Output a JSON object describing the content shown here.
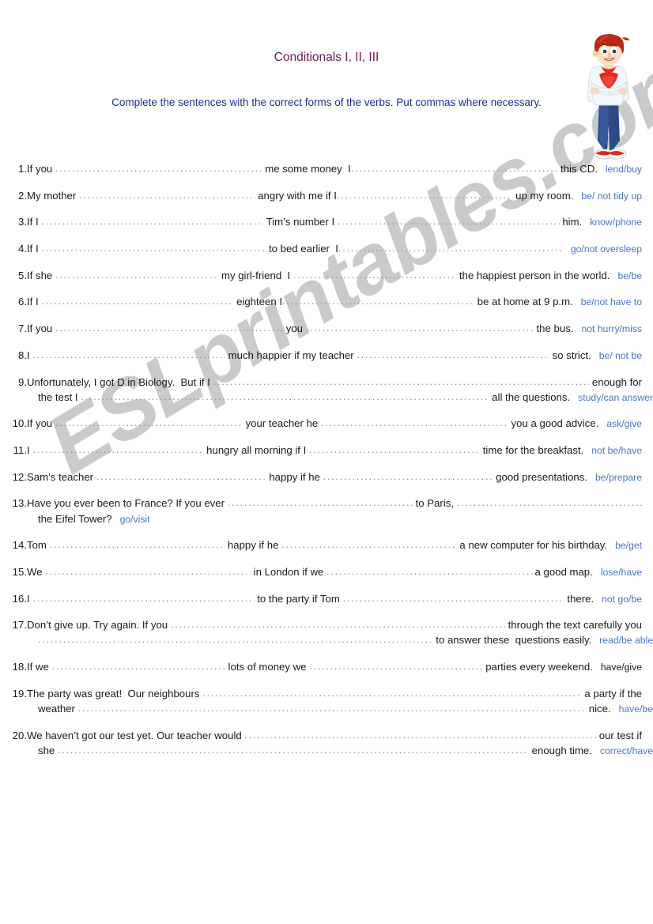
{
  "header": {
    "title": "Conditionals I, II, III",
    "instruction": "Complete the sentences with the correct forms of the verbs. Put commas where necessary."
  },
  "watermark": {
    "text": "ESLprintables.com"
  },
  "illustration": {
    "name": "boy-with-crossed-arms",
    "hair_color": "#b82a17",
    "shirt_color": "#f2f7fb",
    "shirt_accent_color": "#e02a1c",
    "jeans_color": "#2e4a86",
    "shoe_color": "#e02a1c",
    "skin_color": "#f7d9bd"
  },
  "colors": {
    "title": "#6b1a56",
    "instruction": "#1f2f8e",
    "cue": "#4876c4",
    "body": "#1a1a1a",
    "dots": "#8e8e8e",
    "watermark": "#c9cacb"
  },
  "exercises": [
    {
      "number": "1.",
      "lines": [
        {
          "parts": [
            "If you ",
            "BLANK",
            " me some money  I",
            "BLANK",
            " this CD."
          ]
        }
      ],
      "cue": "lend/buy",
      "cue_color": "blue"
    },
    {
      "number": "2.",
      "lines": [
        {
          "parts": [
            "My mother ",
            "BLANK",
            " angry with me if I",
            "BLANK",
            " up my room."
          ]
        }
      ],
      "cue": "be/ not tidy up",
      "cue_color": "blue"
    },
    {
      "number": "3.",
      "lines": [
        {
          "parts": [
            "If I ",
            "BLANK",
            " Tim’s number I ",
            "BLANK",
            " him."
          ]
        }
      ],
      "cue": "know/phone",
      "cue_color": "blue"
    },
    {
      "number": "4.",
      "lines": [
        {
          "parts": [
            "If I ",
            "BLANK",
            " to bed earlier  I",
            "BLANK",
            ""
          ]
        }
      ],
      "cue": "go/not oversleep",
      "cue_color": "blue"
    },
    {
      "number": "5.",
      "lines": [
        {
          "parts": [
            "If she ",
            "BLANK",
            " my girl-friend  I ",
            "BLANK",
            " the happiest person in the world."
          ]
        }
      ],
      "cue": "be/be",
      "cue_color": "blue"
    },
    {
      "number": "6.",
      "lines": [
        {
          "parts": [
            "If I ",
            "BLANK",
            " eighteen I",
            "BLANK",
            " be at home at 9 p.m."
          ]
        }
      ],
      "cue": "be/not have to",
      "cue_color": "blue"
    },
    {
      "number": "7.",
      "lines": [
        {
          "parts": [
            "If you ",
            "BLANK",
            " you ",
            "BLANK",
            " the bus."
          ]
        }
      ],
      "cue": "not hurry/miss",
      "cue_color": "blue"
    },
    {
      "number": "8.",
      "lines": [
        {
          "parts": [
            "I ",
            "BLANK",
            " much happier if my teacher ",
            "BLANK",
            " so strict."
          ]
        }
      ],
      "cue": "be/ not be",
      "cue_color": "blue"
    },
    {
      "number": "9.",
      "lines": [
        {
          "parts": [
            "Unfortunately, I got D in Biology.  But if I ",
            "BLANK",
            " enough for"
          ]
        },
        {
          "parts": [
            "the test I ",
            "BLANK",
            " all the questions."
          ]
        }
      ],
      "cue": "study/can answer",
      "cue_color": "blue"
    },
    {
      "number": "10.",
      "lines": [
        {
          "parts": [
            "If you ",
            "BLANK",
            " your teacher he ",
            "BLANK",
            " you a good advice."
          ]
        }
      ],
      "cue": "ask/give",
      "cue_color": "blue"
    },
    {
      "number": "11.",
      "lines": [
        {
          "parts": [
            "I ",
            "BLANK",
            " hungry all morning if I ",
            "BLANK",
            " time for the breakfast."
          ]
        }
      ],
      "cue": "not be/have",
      "cue_color": "blue"
    },
    {
      "number": "12.",
      "lines": [
        {
          "parts": [
            "Sam’s teacher ",
            "BLANK",
            " happy if he ",
            "BLANK",
            " good presentations."
          ]
        }
      ],
      "cue": "be/prepare",
      "cue_color": "blue"
    },
    {
      "number": "13.",
      "lines": [
        {
          "parts": [
            "Have you ever been to France? If you ever ",
            "BLANK",
            " to Paris, ",
            "BLANK",
            ""
          ]
        },
        {
          "parts": [
            "the Eifel Tower?"
          ]
        }
      ],
      "cue": "go/visit",
      "cue_color": "blue"
    },
    {
      "number": "14.",
      "lines": [
        {
          "parts": [
            "Tom ",
            "BLANK",
            " happy if he ",
            "BLANK",
            " a new computer for his birthday."
          ]
        }
      ],
      "cue": "be/get",
      "cue_color": "blue"
    },
    {
      "number": "15.",
      "lines": [
        {
          "parts": [
            "We ",
            "BLANK",
            " in London if we ",
            "BLANK",
            " a good map."
          ]
        }
      ],
      "cue": "lose/have",
      "cue_color": "blue"
    },
    {
      "number": "16.",
      "lines": [
        {
          "parts": [
            "I ",
            "BLANK",
            " to the party if Tom ",
            "BLANK",
            " there."
          ]
        }
      ],
      "cue": "not go/be",
      "cue_color": "blue"
    },
    {
      "number": "17.",
      "lines": [
        {
          "parts": [
            "Don’t give up. Try again. If you ",
            "BLANK",
            " through the text carefully you"
          ]
        },
        {
          "parts": [
            "BLANK",
            " to answer these  questions easily."
          ]
        }
      ],
      "cue": "read/be able",
      "cue_color": "blue"
    },
    {
      "number": "18.",
      "lines": [
        {
          "parts": [
            "If we ",
            "BLANK",
            " lots of money we ",
            "BLANK",
            " parties every weekend."
          ]
        }
      ],
      "cue": "have/give",
      "cue_color": "dark"
    },
    {
      "number": "19.",
      "lines": [
        {
          "parts": [
            "The party was great!  Our neighbours ",
            "BLANK",
            " a party if the"
          ]
        },
        {
          "parts": [
            "weather ",
            "BLANK",
            " nice."
          ]
        }
      ],
      "cue": "have/be",
      "cue_color": "blue"
    },
    {
      "number": "20.",
      "lines": [
        {
          "parts": [
            "We haven’t got our test yet. Our teacher would ",
            "BLANK",
            " our test if"
          ]
        },
        {
          "parts": [
            "she ",
            "BLANK",
            " enough time."
          ]
        }
      ],
      "cue": "correct/have",
      "cue_color": "blue"
    }
  ]
}
